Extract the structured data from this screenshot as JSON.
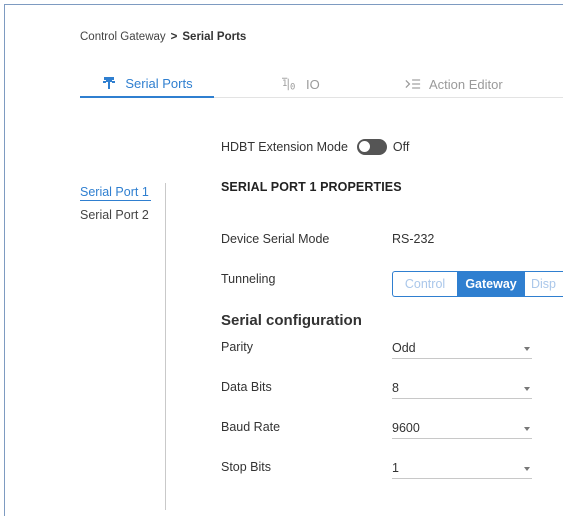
{
  "breadcrumb": {
    "parent": "Control Gateway",
    "separator": ">",
    "current": "Serial Ports"
  },
  "tabs": [
    {
      "label": "Serial Ports",
      "icon": "serial-port-icon",
      "active": true
    },
    {
      "label": "IO",
      "icon": "io-icon",
      "active": false
    },
    {
      "label": "Action Editor",
      "icon": "action-editor-icon",
      "active": false
    }
  ],
  "hdbt": {
    "label": "HDBT Extension Mode",
    "state": "Off"
  },
  "sidebar": {
    "items": [
      {
        "label": "Serial Port 1",
        "active": true
      },
      {
        "label": "Serial Port 2",
        "active": false
      }
    ]
  },
  "properties": {
    "title": "SERIAL PORT 1 PROPERTIES",
    "device_serial_mode": {
      "label": "Device Serial Mode",
      "value": "RS-232"
    },
    "tunneling": {
      "label": "Tunneling",
      "options": [
        "Control",
        "Gateway",
        "Disp"
      ],
      "selected": "Gateway"
    },
    "serial_config_title": "Serial configuration",
    "parity": {
      "label": "Parity",
      "value": "Odd"
    },
    "data_bits": {
      "label": "Data Bits",
      "value": "8"
    },
    "baud_rate": {
      "label": "Baud Rate",
      "value": "9600"
    },
    "stop_bits": {
      "label": "Stop Bits",
      "value": "1"
    }
  },
  "colors": {
    "accent": "#2f7fd0",
    "muted_accent": "#aac7ea",
    "frame_border": "#7e9bc1",
    "toggle_off": "#555555"
  }
}
